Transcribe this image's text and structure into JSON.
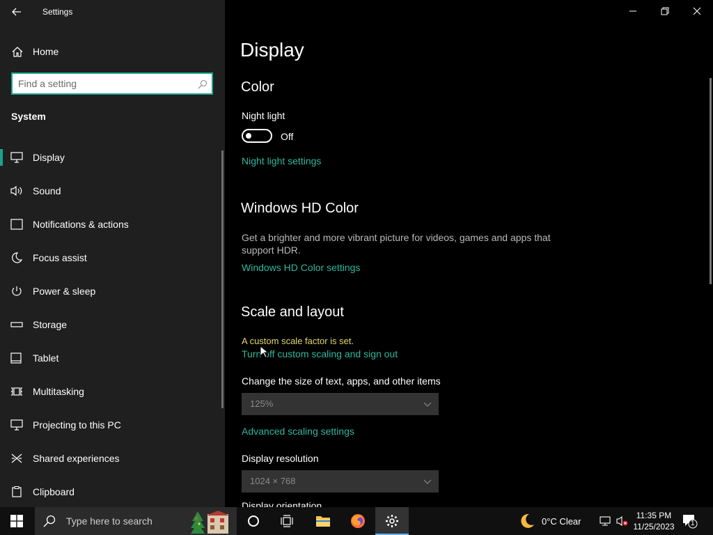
{
  "window": {
    "title": "Settings"
  },
  "sidebar": {
    "home_label": "Home",
    "search_placeholder": "Find a setting",
    "section": "System",
    "items": [
      {
        "label": "Display",
        "icon": "monitor-icon",
        "active": true
      },
      {
        "label": "Sound",
        "icon": "speaker-icon"
      },
      {
        "label": "Notifications & actions",
        "icon": "notification-icon"
      },
      {
        "label": "Focus assist",
        "icon": "moon-icon"
      },
      {
        "label": "Power & sleep",
        "icon": "power-icon"
      },
      {
        "label": "Storage",
        "icon": "storage-icon"
      },
      {
        "label": "Tablet",
        "icon": "tablet-icon"
      },
      {
        "label": "Multitasking",
        "icon": "multitasking-icon"
      },
      {
        "label": "Projecting to this PC",
        "icon": "projecting-icon"
      },
      {
        "label": "Shared experiences",
        "icon": "shared-experiences-icon"
      },
      {
        "label": "Clipboard",
        "icon": "clipboard-icon"
      }
    ]
  },
  "main": {
    "title": "Display",
    "color": {
      "heading": "Color",
      "night_light_label": "Night light",
      "night_light_state": "Off",
      "night_light_link": "Night light settings"
    },
    "hd_color": {
      "heading": "Windows HD Color",
      "description": "Get a brighter and more vibrant picture for videos, games and apps that support HDR.",
      "link": "Windows HD Color settings"
    },
    "scale": {
      "heading": "Scale and layout",
      "warning": "A custom scale factor is set.",
      "signout_link": "Turn off custom scaling and sign out",
      "size_label": "Change the size of text, apps, and other items",
      "size_value": "125%",
      "advanced_link": "Advanced scaling settings",
      "resolution_label": "Display resolution",
      "resolution_value": "1024 × 768",
      "orientation_label": "Display orientation"
    }
  },
  "taskbar": {
    "search_placeholder": "Type here to search",
    "weather": "0°C  Clear",
    "time": "11:35 PM",
    "date": "11/25/2023",
    "notification_count": "1"
  },
  "colors": {
    "accent": "#1aa38e",
    "link": "#2fb7a0",
    "warning": "#e5d96c",
    "sidebar_bg": "#1f1f1f"
  }
}
